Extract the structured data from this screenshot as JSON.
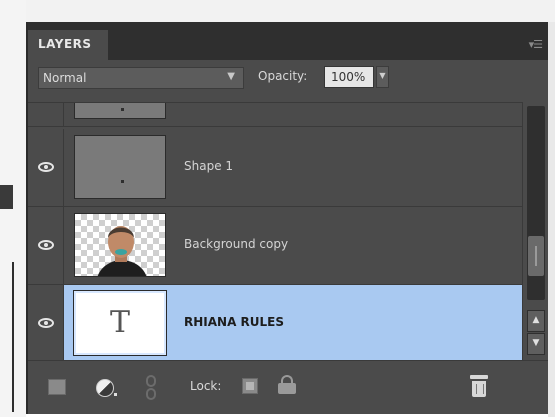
{
  "panel": {
    "tab_label": "LAYERS",
    "menu_icon": "panel-menu-icon"
  },
  "options": {
    "blend_mode": "Normal",
    "opacity_label": "Opacity:",
    "opacity_value": "100%"
  },
  "layers": [
    {
      "name": "Shape 1",
      "visible": true,
      "thumbnail": "gray-shape",
      "selected": false
    },
    {
      "name": "Background copy",
      "visible": true,
      "thumbnail": "photo-person",
      "selected": false
    },
    {
      "name": "RHIANA RULES",
      "visible": true,
      "thumbnail": "type-layer",
      "type_glyph": "T",
      "selected": true
    }
  ],
  "footer": {
    "lock_label": "Lock:"
  },
  "colors": {
    "panel_bg": "#4b4b4b",
    "selection": "#a9c9f1",
    "header_bg": "#2f2f2f"
  }
}
